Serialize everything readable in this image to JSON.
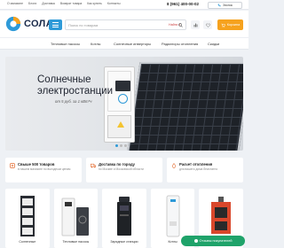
{
  "topbar": {
    "links": [
      "О магазине",
      "Блоги",
      "Доставка",
      "Возврат товара",
      "Как купить",
      "Контакты"
    ],
    "phone": "8 (961) 400-00-02",
    "callback_label": "Звонок"
  },
  "header": {
    "logo_text": "СОЛАР",
    "search_placeholder": "Поиск по товарам",
    "search_category": "Найти в",
    "cart_label": "Корзина"
  },
  "nav": {
    "items": [
      "Тепловые насосы",
      "Котлы",
      "Солнечные инверторы",
      "Радиаторы отопления",
      "Скидки"
    ]
  },
  "hero": {
    "title": "Солнечные\nэлектростанции",
    "subtitle_prefix": "от 5 руб. за 1 кВт*ч",
    "subtitle_accent": ""
  },
  "features": [
    {
      "title": "Свыше 500 товаров",
      "desc": "в нашем магазине по выгодным ценам"
    },
    {
      "title": "Доставка по городу",
      "desc": "по Москве и Московской области"
    },
    {
      "title": "Расчет отопления",
      "desc": "для вашего дома бесплатно"
    }
  ],
  "products": [
    {
      "label": "Солнечные"
    },
    {
      "label": "Тепловые насосы"
    },
    {
      "label": "Зарядные станции"
    },
    {
      "label": "Котлы"
    },
    {
      "label": "Печи"
    }
  ],
  "chat": {
    "label": "Отзывы покупателей"
  },
  "colors": {
    "accent": "#2e9ad8",
    "cart": "#f6a21e",
    "chat": "#1fa36a",
    "hero_accent": "#e36a2e"
  }
}
